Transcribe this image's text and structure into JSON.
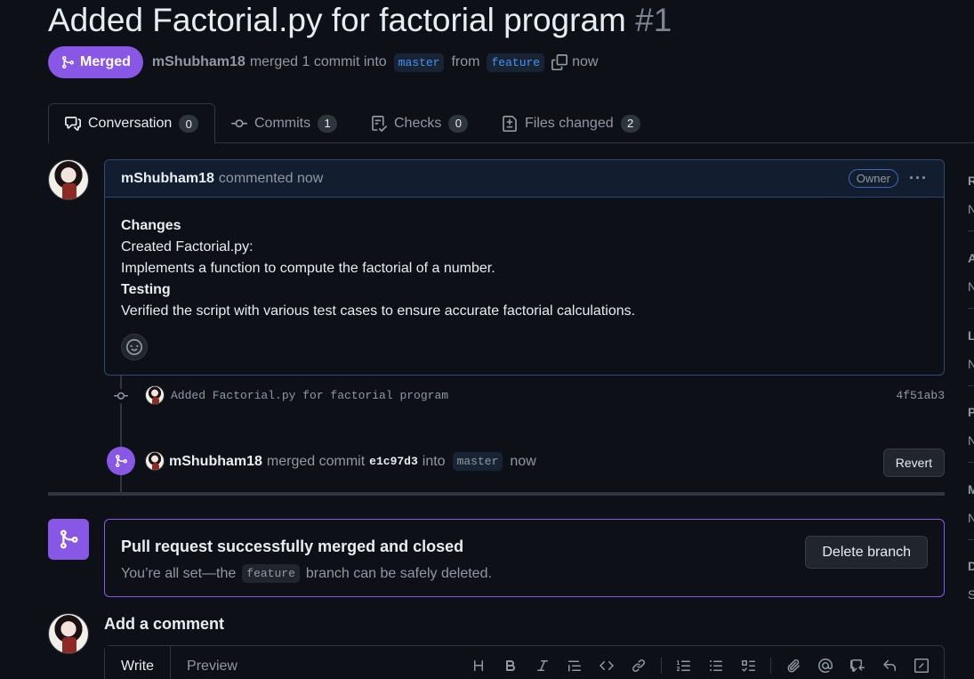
{
  "pr": {
    "title": "Added Factorial.py for factorial program",
    "number": "#1",
    "state": "Merged",
    "author": "mShubham18",
    "merge_text": "merged 1 commit into",
    "base_branch": "master",
    "from_text": "from",
    "head_branch": "feature",
    "time": "now"
  },
  "tabs": [
    {
      "label": "Conversation",
      "count": "0",
      "icon": "comment-discussion-icon"
    },
    {
      "label": "Commits",
      "count": "1",
      "icon": "git-commit-icon"
    },
    {
      "label": "Checks",
      "count": "0",
      "icon": "checklist-icon"
    },
    {
      "label": "Files changed",
      "count": "2",
      "icon": "file-diff-icon"
    }
  ],
  "comment": {
    "author": "mShubham18",
    "action": "commented now",
    "badge": "Owner",
    "more": "···",
    "lines": [
      {
        "text": "Changes",
        "bold": true
      },
      {
        "text": "Created Factorial.py:",
        "bold": false
      },
      {
        "text": "Implements a function to compute the factorial of a number.",
        "bold": false
      },
      {
        "text": "Testing",
        "bold": true
      },
      {
        "text": "Verified the script with various test cases to ensure accurate factorial calculations.",
        "bold": false
      }
    ]
  },
  "commit": {
    "message": "Added Factorial.py for factorial program",
    "sha": "4f51ab3"
  },
  "merge_event": {
    "author": "mShubham18",
    "action": "merged commit",
    "sha": "e1c97d3",
    "into": "into",
    "branch": "master",
    "time": "now",
    "revert_label": "Revert"
  },
  "merged_box": {
    "title": "Pull request successfully merged and closed",
    "desc_before": "You’re all set—the",
    "branch": "feature",
    "desc_after": "branch can be safely deleted.",
    "delete_label": "Delete branch"
  },
  "add_comment": {
    "title": "Add a comment",
    "write_tab": "Write",
    "preview_tab": "Preview",
    "tools": [
      "heading-icon",
      "bold-icon",
      "italic-icon",
      "quote-icon",
      "code-icon",
      "link-icon",
      "ordered-list-icon",
      "unordered-list-icon",
      "task-list-icon",
      "attach-icon",
      "mention-icon",
      "cross-reference-icon",
      "reply-icon",
      "slash-command-icon"
    ]
  },
  "sidebar": {
    "items": [
      {
        "head": "R",
        "value": "N"
      },
      {
        "head": "A",
        "value": "N"
      },
      {
        "head": "L",
        "value": "N"
      },
      {
        "head": "P",
        "value": "N"
      },
      {
        "head": "M",
        "value": "N"
      },
      {
        "head": "D",
        "value": "S"
      }
    ]
  },
  "colors": {
    "merged": "#8957e5",
    "link": "#4493f8",
    "bg": "#0d1117",
    "border": "#30363d"
  }
}
